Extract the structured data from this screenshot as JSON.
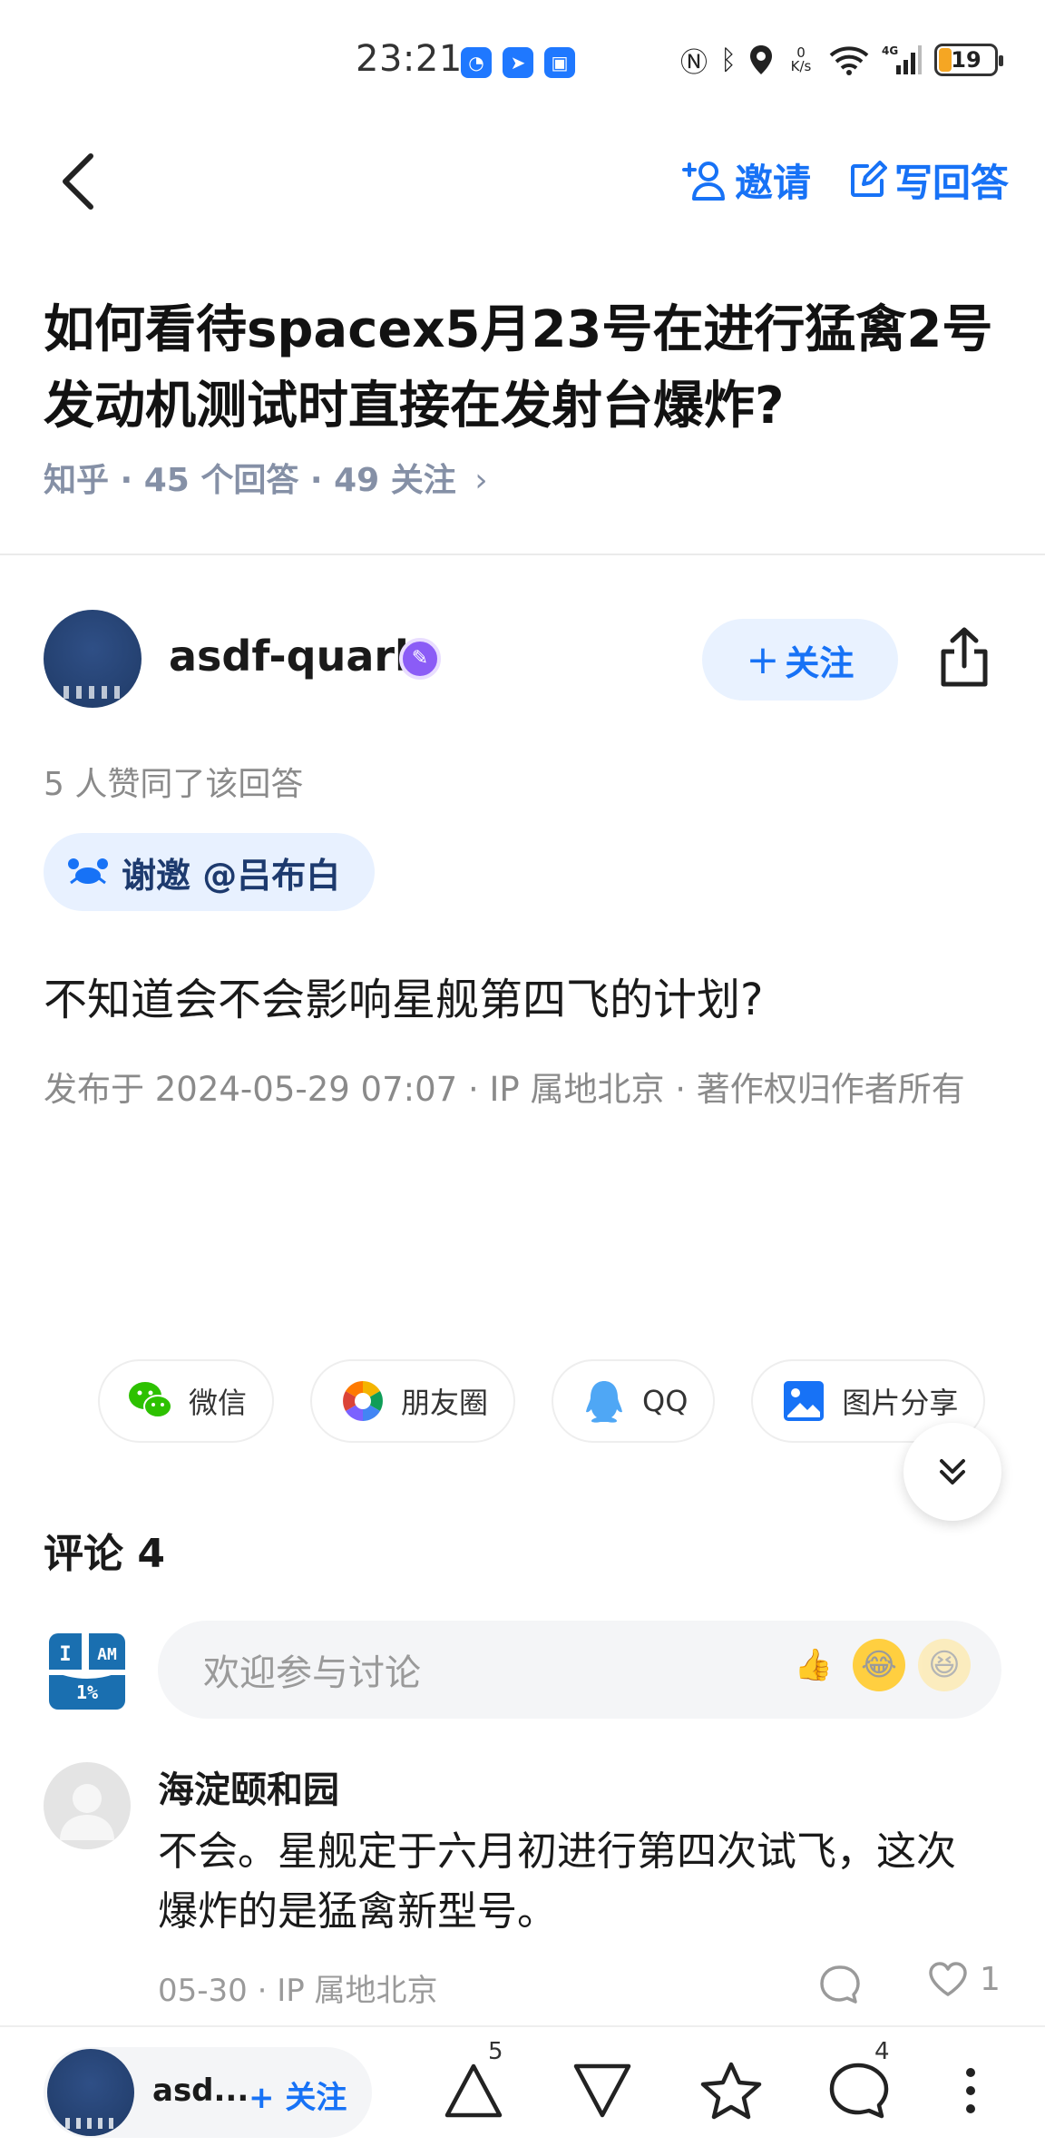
{
  "status_bar": {
    "time": "23:21",
    "battery": "19",
    "net_speed": "0 K/s"
  },
  "header": {
    "invite_label": "邀请",
    "write_answer_label": "写回答"
  },
  "question": {
    "title": "如何看待spacex5月23号在进行猛禽2号发动机测试时直接在发射台爆炸?",
    "meta": "知乎 · 45 个回答 · 49 关注"
  },
  "author": {
    "name": "asdf-quark",
    "follow_label": "关注"
  },
  "answer": {
    "upvote_text": "5 人赞同了该回答",
    "invite_text": "谢邀 @吕布白",
    "content": "不知道会不会影响星舰第四飞的计划?",
    "publish_meta": "发布于 2024-05-29 07:07 · IP 属地北京 · 著作权归作者所有"
  },
  "share": [
    {
      "label": "微信",
      "icon": "wechat-icon"
    },
    {
      "label": "朋友圈",
      "icon": "moments-icon"
    },
    {
      "label": "QQ",
      "icon": "qq-icon"
    },
    {
      "label": "图片分享",
      "icon": "image-share-icon"
    }
  ],
  "comments": {
    "title": "评论 4",
    "input_placeholder": "欢迎参与讨论",
    "my_avatar_text": {
      "i": "I",
      "am": "AM",
      "pct": "1%"
    },
    "items": [
      {
        "user": "海淀颐和园",
        "text": "不会。星舰定于六月初进行第四次试飞，这次爆炸的是猛禽新型号。",
        "meta": "05-30 · IP 属地北京",
        "likes": "1"
      }
    ]
  },
  "bottom_bar": {
    "author_short": "asd...",
    "follow_label": "关注",
    "upvote_count": "5",
    "comment_count": "4"
  },
  "colors": {
    "accent": "#1772f6",
    "text": "#1a1a1a",
    "muted": "#8a8a8a"
  }
}
